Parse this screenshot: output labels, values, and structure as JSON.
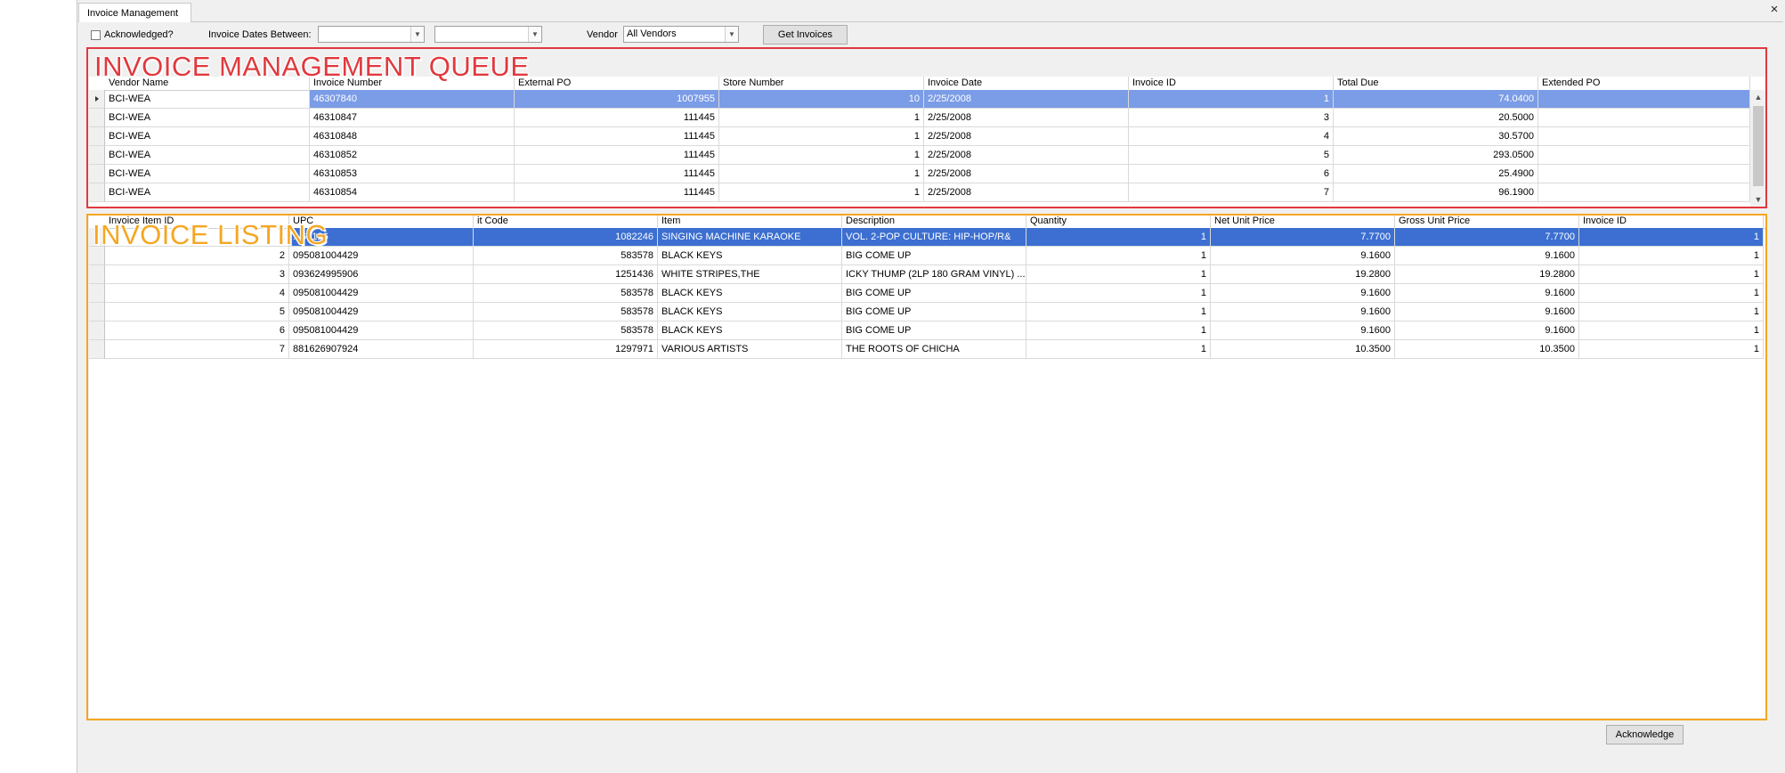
{
  "window": {
    "tab_label": "Invoice Management",
    "close_glyph": "×"
  },
  "toolbar": {
    "acknowledged_label": "Acknowledged?",
    "acknowledged_checked": false,
    "dates_label": "Invoice Dates Between:",
    "date_from": "",
    "date_to": "",
    "vendor_label": "Vendor",
    "vendor_value": "All Vendors",
    "get_invoices_label": "Get Invoices"
  },
  "queue": {
    "overlay_title": "INVOICE MANAGEMENT QUEUE",
    "overlay_color": "#e0393e",
    "columns": [
      "Vendor Name",
      "Invoice Number",
      "External PO",
      "Store Number",
      "Invoice Date",
      "Invoice ID",
      "Total Due",
      "Extended PO"
    ],
    "rows": [
      [
        "BCI-WEA",
        "46307840",
        "1007955",
        "10",
        "2/25/2008",
        "1",
        "74.0400",
        ""
      ],
      [
        "BCI-WEA",
        "46310847",
        "111445",
        "1",
        "2/25/2008",
        "3",
        "20.5000",
        ""
      ],
      [
        "BCI-WEA",
        "46310848",
        "111445",
        "1",
        "2/25/2008",
        "4",
        "30.5700",
        ""
      ],
      [
        "BCI-WEA",
        "46310852",
        "111445",
        "1",
        "2/25/2008",
        "5",
        "293.0500",
        ""
      ],
      [
        "BCI-WEA",
        "46310853",
        "111445",
        "1",
        "2/25/2008",
        "6",
        "25.4900",
        ""
      ],
      [
        "BCI-WEA",
        "46310854",
        "111445",
        "1",
        "2/25/2008",
        "7",
        "96.1900",
        ""
      ]
    ],
    "selected_row": 0,
    "selection_color": "#7b9ce6"
  },
  "listing": {
    "overlay_title": "INVOICE LISTING",
    "overlay_color": "#f5a623",
    "columns": [
      "Invoice Item ID",
      "UPC",
      "it Code",
      "Item",
      "Description",
      "Quantity",
      "Net Unit Price",
      "Gross Unit Price",
      "Invoice ID"
    ],
    "rows": [
      [
        "1",
        "...63126",
        "1082246",
        "SINGING MACHINE KARAOKE",
        "VOL. 2-POP CULTURE: HIP-HOP/R&",
        "1",
        "7.7700",
        "7.7700",
        "1"
      ],
      [
        "2",
        "095081004429",
        "583578",
        "BLACK KEYS",
        "BIG COME UP",
        "1",
        "9.1600",
        "9.1600",
        "1"
      ],
      [
        "3",
        "093624995906",
        "1251436",
        "WHITE STRIPES,THE",
        "ICKY THUMP (2LP 180 GRAM VINYL)      ...",
        "1",
        "19.2800",
        "19.2800",
        "1"
      ],
      [
        "4",
        "095081004429",
        "583578",
        "BLACK KEYS",
        "BIG COME UP",
        "1",
        "9.1600",
        "9.1600",
        "1"
      ],
      [
        "5",
        "095081004429",
        "583578",
        "BLACK KEYS",
        "BIG COME UP",
        "1",
        "9.1600",
        "9.1600",
        "1"
      ],
      [
        "6",
        "095081004429",
        "583578",
        "BLACK KEYS",
        "BIG COME UP",
        "1",
        "9.1600",
        "9.1600",
        "1"
      ],
      [
        "7",
        "881626907924",
        "1297971",
        "VARIOUS ARTISTS",
        "THE ROOTS OF CHICHA",
        "1",
        "10.3500",
        "10.3500",
        "1"
      ]
    ],
    "selected_row": 0,
    "selection_color": "#3c6fd1"
  },
  "footer": {
    "acknowledge_label": "Acknowledge"
  }
}
